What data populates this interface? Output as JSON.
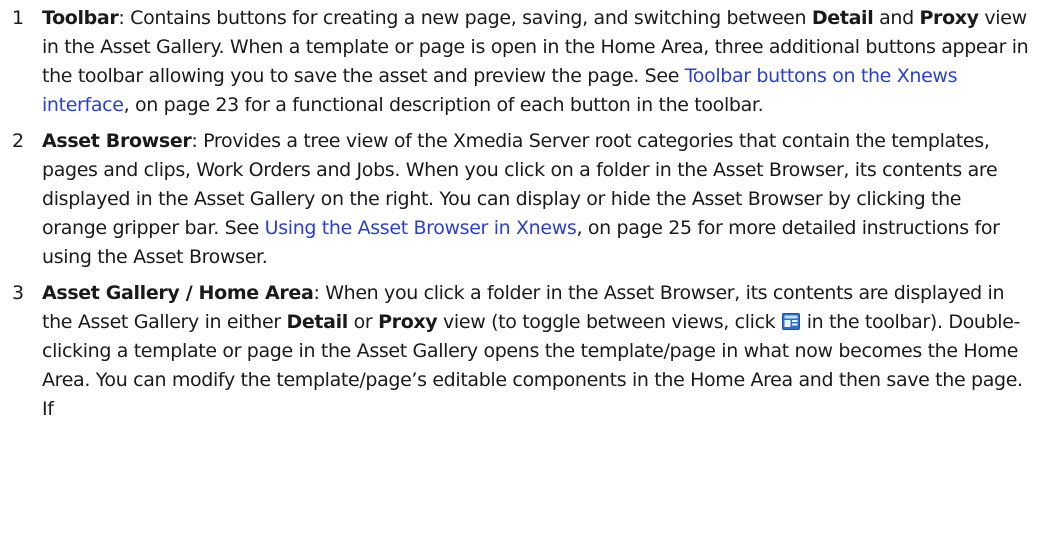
{
  "items": [
    {
      "number": "1",
      "term": "Toolbar",
      "text_a": ": Contains buttons for creating a new page, saving, and switching between ",
      "kw1": "Detail",
      "text_b": " and ",
      "kw2": "Proxy",
      "text_c": " view in the Asset Gallery. When a template or page is open in the Home Area, three additional buttons appear in the toolbar allowing you to save the asset and preview the page. See ",
      "link": "Toolbar buttons on the Xnews interface",
      "text_d": ", on page 23 for a functional description of each button in the toolbar."
    },
    {
      "number": "2",
      "term": "Asset Browser",
      "text_a": ": Provides a tree view of the Xmedia Server root categories that contain the templates, pages and clips, Work Orders and Jobs. When you click on a folder in the Asset Browser, its contents are displayed in the Asset Gallery on the right. You can display or hide the Asset Browser by clicking the orange gripper bar. See ",
      "link": "Using the Asset Browser in Xnews",
      "text_b": ", on page 25 for more detailed instructions for using the Asset Browser."
    },
    {
      "number": "3",
      "term": "Asset Gallery / Home Area",
      "text_a": ": When you click a folder in the Asset Browser, its contents are displayed in the Asset Gallery in either ",
      "kw1": "Detail",
      "text_b": " or ",
      "kw2": "Proxy",
      "text_c": " view (to toggle between views, click ",
      "icon": "detail-proxy-toggle-icon",
      "text_d": " in the toolbar). Double-clicking a template or page in the Asset Gallery opens the template/page in what now becomes the Home Area. You can modify the template/page’s editable components in the Home Area and then save the page. If"
    }
  ],
  "colors": {
    "text": "#1a1a1a",
    "link": "#2a3fd0",
    "icon_blue": "#2b6fd6"
  }
}
